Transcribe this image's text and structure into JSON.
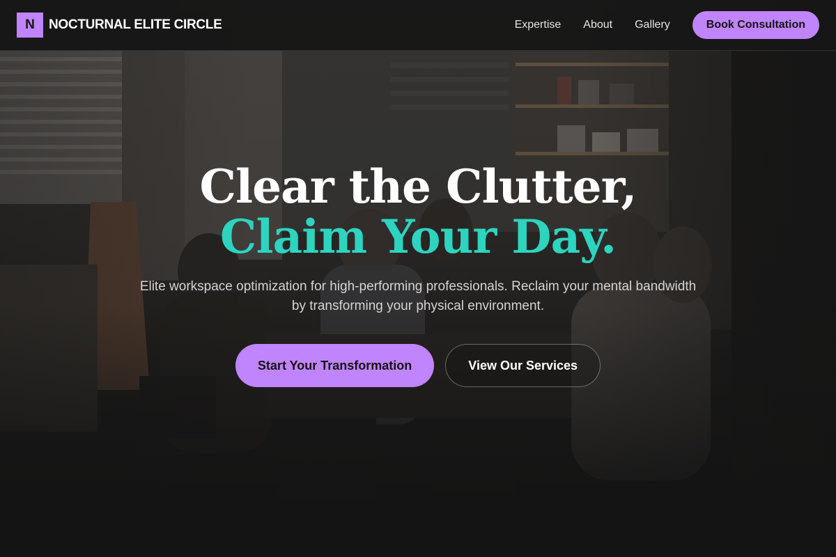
{
  "brand": {
    "mark": "N",
    "name": "NOCTURNAL ELITE CIRCLE"
  },
  "nav": {
    "links": [
      "Expertise",
      "About",
      "Gallery"
    ],
    "cta_label": "Book Consultation"
  },
  "hero": {
    "headline_line1": "Clear the Clutter,",
    "headline_line2": "Claim Your Day.",
    "subtitle": "Elite workspace optimization for high-performing professionals. Reclaim your mental bandwidth by transforming your physical environment.",
    "primary_cta": "Start Your Transformation",
    "secondary_cta": "View Our Services",
    "background_image": "office-meeting-photo"
  },
  "colors": {
    "accent_purple": "#c084fc",
    "accent_teal": "#2dd4bf",
    "background": "#141414"
  }
}
